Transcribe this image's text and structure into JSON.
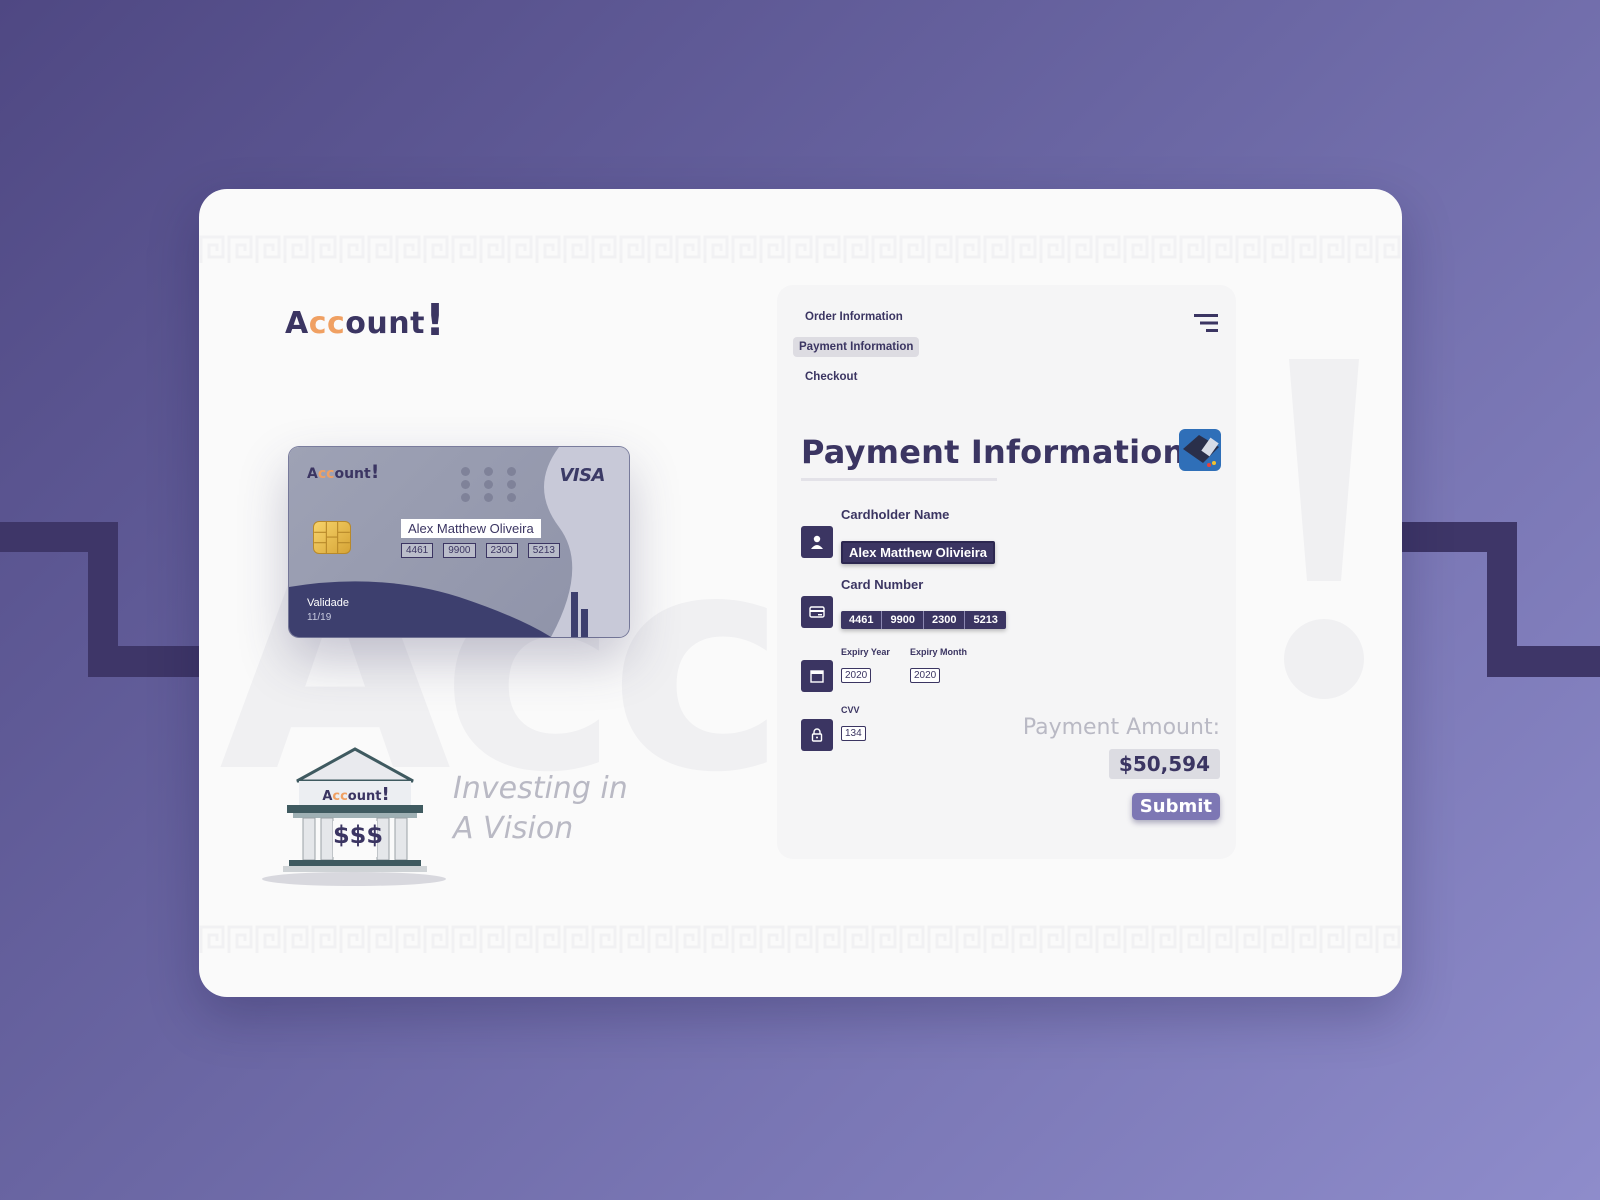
{
  "brand": {
    "logo_prefix": "A",
    "logo_cc": "cc",
    "logo_suffix": "ount",
    "logo_bang": "!"
  },
  "card": {
    "name": "Alex Matthew Oliveira",
    "numbers": [
      "4461",
      "9900",
      "2300",
      "5213"
    ],
    "network": "VISA",
    "validity_label": "Validade",
    "validity_value": "11/19"
  },
  "bank": {
    "money_text": "$$$",
    "tagline_line1": "Investing in",
    "tagline_line2": "A Vision"
  },
  "nav": {
    "items": [
      "Order Information",
      "Payment Information",
      "Checkout"
    ],
    "active": "Payment Information"
  },
  "form": {
    "title": "Payment Information",
    "cardholder_label": "Cardholder Name",
    "cardholder_value": "Alex Matthew Olivieira",
    "card_number_label": "Card Number",
    "card_number_parts": [
      "4461",
      "9900",
      "2300",
      "5213"
    ],
    "expiry_year_label": "Expiry Year",
    "expiry_year_value": "2020",
    "expiry_month_label": "Expiry Month",
    "expiry_month_value": "2020",
    "cvv_label": "CVV",
    "cvv_value": "134",
    "amount_label": "Payment Amount:",
    "amount_value": "$50,594",
    "submit_label": "Submit"
  },
  "icons": {
    "menu": "menu-lines-icon",
    "pos": "card-terminal-icon",
    "user": "user-icon",
    "card": "credit-card-icon",
    "calendar": "calendar-icon",
    "lock": "lock-icon"
  },
  "colors": {
    "primary": "#3b3562",
    "accent": "#f0a062",
    "button": "#7d77b4",
    "background_start": "#4f4883",
    "background_end": "#8e8ccb"
  }
}
